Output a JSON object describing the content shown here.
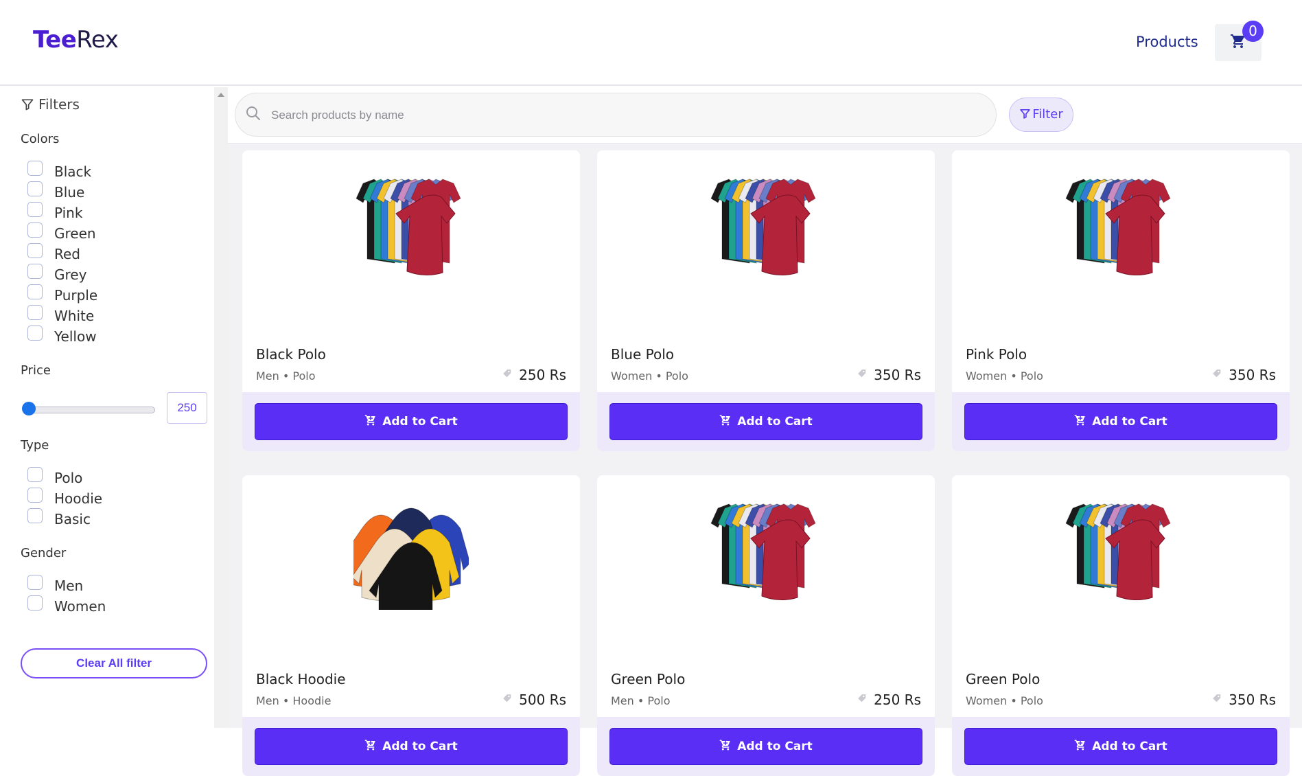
{
  "header": {
    "logo_part1": "Tee",
    "logo_part2": "Rex",
    "nav_products": "Products",
    "cart_count": "0"
  },
  "sidebar": {
    "filters_title": "Filters",
    "colors_title": "Colors",
    "colors": [
      "Black",
      "Blue",
      "Pink",
      "Green",
      "Red",
      "Grey",
      "Purple",
      "White",
      "Yellow"
    ],
    "price_title": "Price",
    "price_value": "250",
    "price_slider_level": 0.0,
    "type_title": "Type",
    "types": [
      "Polo",
      "Hoodie",
      "Basic"
    ],
    "gender_title": "Gender",
    "genders": [
      "Men",
      "Women"
    ],
    "clear_label": "Clear All filter"
  },
  "search": {
    "placeholder": "Search products by name",
    "filter_label": "Filter"
  },
  "products": [
    {
      "name": "Black Polo",
      "meta": "Men • Polo",
      "price": "250 Rs",
      "image": "polo-stack-icon"
    },
    {
      "name": "Blue Polo",
      "meta": "Women • Polo",
      "price": "350 Rs",
      "image": "polo-stack-icon"
    },
    {
      "name": "Pink Polo",
      "meta": "Women • Polo",
      "price": "350 Rs",
      "image": "polo-stack-icon"
    },
    {
      "name": "Black Hoodie",
      "meta": "Men • Hoodie",
      "price": "500 Rs",
      "image": "hoodie-stack-icon"
    },
    {
      "name": "Green Polo",
      "meta": "Men • Polo",
      "price": "250 Rs",
      "image": "polo-stack-icon"
    },
    {
      "name": "Green Polo",
      "meta": "Women • Polo",
      "price": "350 Rs",
      "image": "polo-stack-icon"
    }
  ],
  "add_to_cart_label": "Add to Cart",
  "colors_theme": {
    "accent": "#5b2ef5",
    "logo_accent": "#4b1ed1",
    "card_footer": "#ede9fb"
  }
}
